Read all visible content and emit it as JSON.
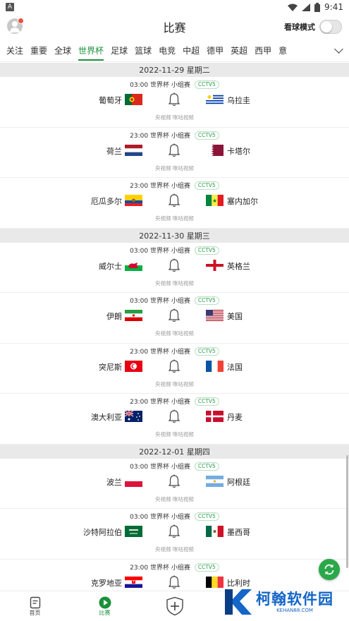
{
  "status_bar": {
    "app_glyph": "A",
    "time": "9:41",
    "icons": [
      "wifi-icon",
      "signal-icon",
      "battery-icon"
    ]
  },
  "header": {
    "title": "比赛",
    "watch_mode_label": "看球模式",
    "watch_mode_on": false
  },
  "tabs": [
    "关注",
    "重要",
    "全球",
    "世界杯",
    "足球",
    "篮球",
    "电竞",
    "中超",
    "德甲",
    "英超",
    "西甲",
    "意"
  ],
  "active_tab": "世界杯",
  "days": [
    {
      "date": "2022-11-29 星期二",
      "matches": [
        {
          "time": "03:00",
          "competition": "世界杯",
          "stage": "小组赛",
          "tv": "CCTV5",
          "home": "葡萄牙",
          "away": "乌拉圭",
          "home_flag": "portugal",
          "away_flag": "uruguay",
          "broadcast": "央视频 咪咕视频"
        },
        {
          "time": "23:00",
          "competition": "世界杯",
          "stage": "小组赛",
          "tv": "CCTV5",
          "home": "荷兰",
          "away": "卡塔尔",
          "home_flag": "netherlands",
          "away_flag": "qatar",
          "broadcast": "央视频 咪咕视频"
        },
        {
          "time": "23:00",
          "competition": "世界杯",
          "stage": "小组赛",
          "tv": "CCTV5",
          "home": "厄瓜多尔",
          "away": "塞内加尔",
          "home_flag": "ecuador",
          "away_flag": "senegal",
          "broadcast": "央视频 咪咕视频"
        }
      ]
    },
    {
      "date": "2022-11-30 星期三",
      "matches": [
        {
          "time": "03:00",
          "competition": "世界杯",
          "stage": "小组赛",
          "tv": "CCTV5",
          "home": "威尔士",
          "away": "英格兰",
          "home_flag": "wales",
          "away_flag": "england",
          "broadcast": "央视频 咪咕视频"
        },
        {
          "time": "03:00",
          "competition": "世界杯",
          "stage": "小组赛",
          "tv": "CCTV5",
          "home": "伊朗",
          "away": "美国",
          "home_flag": "iran",
          "away_flag": "usa",
          "broadcast": "央视频 咪咕视频"
        },
        {
          "time": "23:00",
          "competition": "世界杯",
          "stage": "小组赛",
          "tv": "CCTV5",
          "home": "突尼斯",
          "away": "法国",
          "home_flag": "tunisia",
          "away_flag": "france",
          "broadcast": "央视频 咪咕视频"
        },
        {
          "time": "23:00",
          "competition": "世界杯",
          "stage": "小组赛",
          "tv": "CCTV5",
          "home": "澳大利亚",
          "away": "丹麦",
          "home_flag": "australia",
          "away_flag": "denmark",
          "broadcast": "央视频 咪咕视频"
        }
      ]
    },
    {
      "date": "2022-12-01 星期四",
      "matches": [
        {
          "time": "03:00",
          "competition": "世界杯",
          "stage": "小组赛",
          "tv": "CCTV5",
          "home": "波兰",
          "away": "阿根廷",
          "home_flag": "poland",
          "away_flag": "argentina",
          "broadcast": "央视频 咪咕视频"
        },
        {
          "time": "03:00",
          "competition": "世界杯",
          "stage": "小组赛",
          "tv": "CCTV5",
          "home": "沙特阿拉伯",
          "away": "墨西哥",
          "home_flag": "saudi",
          "away_flag": "mexico",
          "broadcast": "央视频 咪咕视频"
        },
        {
          "time": "23:00",
          "competition": "世界杯",
          "stage": "小组赛",
          "tv": "CCTV5",
          "home": "克罗地亚",
          "away": "比利时",
          "home_flag": "croatia",
          "away_flag": "belgium",
          "broadcast": "央视频 咪咕视频"
        }
      ]
    }
  ],
  "bottom_nav": [
    {
      "label": "首页",
      "icon": "document-icon",
      "active": false
    },
    {
      "label": "比赛",
      "icon": "play-icon",
      "active": true
    },
    {
      "label": "",
      "icon": "shield-plus-icon",
      "active": false
    },
    {
      "label": "",
      "icon": "",
      "active": false
    },
    {
      "label": "",
      "icon": "",
      "active": false
    }
  ],
  "watermark": {
    "main": "柯翰软件园",
    "sub": "KEHAN88.COM"
  },
  "colors": {
    "accent": "#1b8f3a",
    "fab": "#2ba84a",
    "watermark": "#1466c7"
  }
}
